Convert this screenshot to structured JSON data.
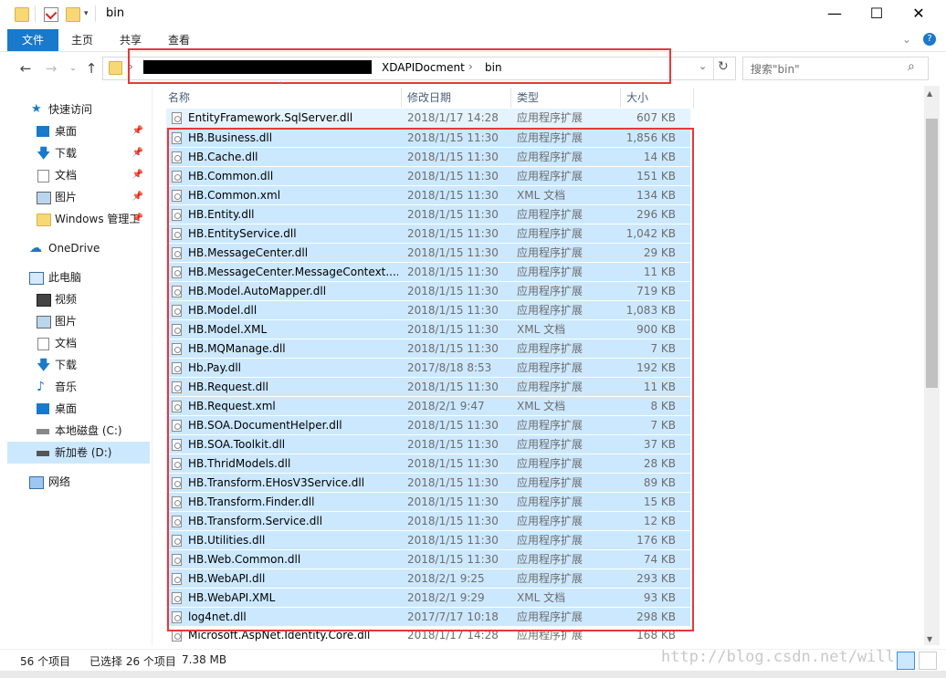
{
  "window": {
    "title": "bin",
    "minimize": "—",
    "maximize": "☐",
    "close": "✕"
  },
  "ribbon": {
    "tabs": [
      {
        "label": "文件"
      },
      {
        "label": "主页"
      },
      {
        "label": "共享"
      },
      {
        "label": "查看"
      }
    ],
    "help": "?"
  },
  "address": {
    "segments": [
      "XDAPIDocment",
      "bin"
    ],
    "separator": "›",
    "search_placeholder": "搜索\"bin\""
  },
  "navpane": {
    "quick_access": "快速访问",
    "items": [
      {
        "label": "桌面"
      },
      {
        "label": "下载"
      },
      {
        "label": "文档"
      },
      {
        "label": "图片"
      },
      {
        "label": "Windows 管理工"
      },
      {
        "label": "OneDrive"
      },
      {
        "label": "此电脑"
      },
      {
        "label": "视频"
      },
      {
        "label": "图片"
      },
      {
        "label": "文档"
      },
      {
        "label": "下载"
      },
      {
        "label": "音乐"
      },
      {
        "label": "桌面"
      },
      {
        "label": "本地磁盘 (C:)"
      },
      {
        "label": "新加卷 (D:)"
      },
      {
        "label": "网络"
      }
    ]
  },
  "columns": {
    "name": "名称",
    "date": "修改日期",
    "type": "类型",
    "size": "大小"
  },
  "files": [
    {
      "name": "EntityFramework.SqlServer.dll",
      "date": "2018/1/17 14:28",
      "type": "应用程序扩展",
      "size": "607 KB"
    },
    {
      "name": "HB.Business.dll",
      "date": "2018/1/15 11:30",
      "type": "应用程序扩展",
      "size": "1,856 KB"
    },
    {
      "name": "HB.Cache.dll",
      "date": "2018/1/15 11:30",
      "type": "应用程序扩展",
      "size": "14 KB"
    },
    {
      "name": "HB.Common.dll",
      "date": "2018/1/15 11:30",
      "type": "应用程序扩展",
      "size": "151 KB"
    },
    {
      "name": "HB.Common.xml",
      "date": "2018/1/15 11:30",
      "type": "XML 文档",
      "size": "134 KB"
    },
    {
      "name": "HB.Entity.dll",
      "date": "2018/1/15 11:30",
      "type": "应用程序扩展",
      "size": "296 KB"
    },
    {
      "name": "HB.EntityService.dll",
      "date": "2018/1/15 11:30",
      "type": "应用程序扩展",
      "size": "1,042 KB"
    },
    {
      "name": "HB.MessageCenter.dll",
      "date": "2018/1/15 11:30",
      "type": "应用程序扩展",
      "size": "29 KB"
    },
    {
      "name": "HB.MessageCenter.MessageContext....",
      "date": "2018/1/15 11:30",
      "type": "应用程序扩展",
      "size": "11 KB"
    },
    {
      "name": "HB.Model.AutoMapper.dll",
      "date": "2018/1/15 11:30",
      "type": "应用程序扩展",
      "size": "719 KB"
    },
    {
      "name": "HB.Model.dll",
      "date": "2018/1/15 11:30",
      "type": "应用程序扩展",
      "size": "1,083 KB"
    },
    {
      "name": "HB.Model.XML",
      "date": "2018/1/15 11:30",
      "type": "XML 文档",
      "size": "900 KB"
    },
    {
      "name": "HB.MQManage.dll",
      "date": "2018/1/15 11:30",
      "type": "应用程序扩展",
      "size": "7 KB"
    },
    {
      "name": "Hb.Pay.dll",
      "date": "2017/8/18 8:53",
      "type": "应用程序扩展",
      "size": "192 KB"
    },
    {
      "name": "HB.Request.dll",
      "date": "2018/1/15 11:30",
      "type": "应用程序扩展",
      "size": "11 KB"
    },
    {
      "name": "HB.Request.xml",
      "date": "2018/2/1 9:47",
      "type": "XML 文档",
      "size": "8 KB"
    },
    {
      "name": "HB.SOA.DocumentHelper.dll",
      "date": "2018/1/15 11:30",
      "type": "应用程序扩展",
      "size": "7 KB"
    },
    {
      "name": "HB.SOA.Toolkit.dll",
      "date": "2018/1/15 11:30",
      "type": "应用程序扩展",
      "size": "37 KB"
    },
    {
      "name": "HB.ThridModels.dll",
      "date": "2018/1/15 11:30",
      "type": "应用程序扩展",
      "size": "28 KB"
    },
    {
      "name": "HB.Transform.EHosV3Service.dll",
      "date": "2018/1/15 11:30",
      "type": "应用程序扩展",
      "size": "89 KB"
    },
    {
      "name": "HB.Transform.Finder.dll",
      "date": "2018/1/15 11:30",
      "type": "应用程序扩展",
      "size": "15 KB"
    },
    {
      "name": "HB.Transform.Service.dll",
      "date": "2018/1/15 11:30",
      "type": "应用程序扩展",
      "size": "12 KB"
    },
    {
      "name": "HB.Utilities.dll",
      "date": "2018/1/15 11:30",
      "type": "应用程序扩展",
      "size": "176 KB"
    },
    {
      "name": "HB.Web.Common.dll",
      "date": "2018/1/15 11:30",
      "type": "应用程序扩展",
      "size": "74 KB"
    },
    {
      "name": "HB.WebAPI.dll",
      "date": "2018/2/1 9:25",
      "type": "应用程序扩展",
      "size": "293 KB"
    },
    {
      "name": "HB.WebAPI.XML",
      "date": "2018/2/1 9:29",
      "type": "XML 文档",
      "size": "93 KB"
    },
    {
      "name": "log4net.dll",
      "date": "2017/7/17 10:18",
      "type": "应用程序扩展",
      "size": "298 KB"
    },
    {
      "name": "Microsoft.AspNet.Identity.Core.dll",
      "date": "2018/1/17 14:28",
      "type": "应用程序扩展",
      "size": "168 KB"
    }
  ],
  "status": {
    "count": "56 个项目",
    "selected": "已选择 26 个项目",
    "size": "7.38 MB"
  },
  "watermark": "http://blog.csdn.net/will",
  "colors": {
    "selection": "#cce8ff",
    "highlight_box": "#e8373a",
    "ribbon_file": "#1979ca"
  }
}
